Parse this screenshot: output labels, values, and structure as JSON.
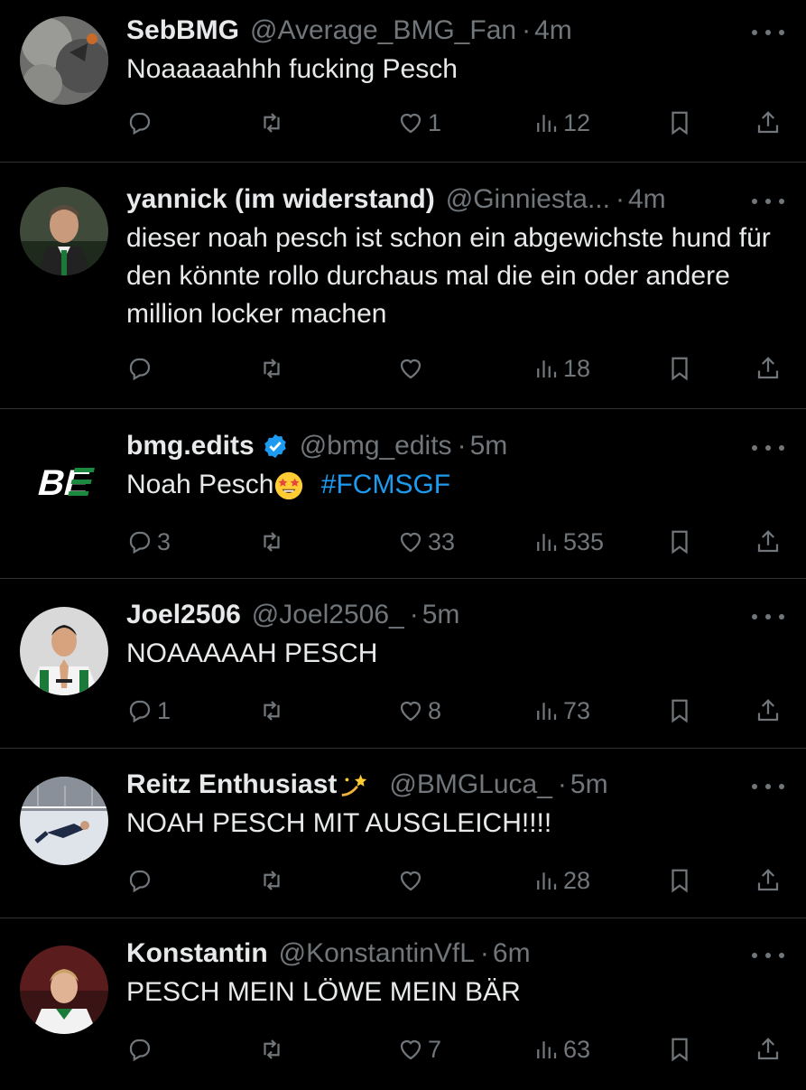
{
  "tweets": [
    {
      "name": "SebBMG",
      "handle": "@Average_BMG_Fan",
      "time": "4m",
      "text": "Noaaaaahhh fucking Pesch",
      "replies": "",
      "retweets": "",
      "likes": "1",
      "views": "12",
      "avatar": "smoky-stadium-avatar"
    },
    {
      "name": "yannick (im widerstand)",
      "handle": "@Ginniesta...",
      "time": "4m",
      "text": "dieser noah pesch ist schon ein abgewichste hund für den könnte rollo durchaus mal die ein oder andere million locker machen",
      "replies": "",
      "retweets": "",
      "likes": "",
      "views": "18",
      "avatar": "man-in-suit-avatar"
    },
    {
      "name": "bmg.edits",
      "handle": "@bmg_edits",
      "time": "5m",
      "text": "Noah Pesch",
      "emoji": "star-struck-emoji",
      "hashtag": "#FCMSGF",
      "replies": "3",
      "retweets": "",
      "likes": "33",
      "views": "535",
      "avatar": "be-logo-avatar",
      "logo_text": "BE",
      "verified": true
    },
    {
      "name": "Joel2506",
      "handle": "@Joel2506_",
      "time": "5m",
      "text": "NOAAAAAH PESCH",
      "replies": "1",
      "retweets": "",
      "likes": "8",
      "views": "73",
      "avatar": "player-praying-avatar"
    },
    {
      "name": "Reitz Enthusiast",
      "name_emoji": "dizzy-emoji",
      "handle": "@BMGLuca_",
      "time": "5m",
      "text": "NOAH PESCH MIT AUSGLEICH!!!!",
      "replies": "",
      "retweets": "",
      "likes": "",
      "views": "28",
      "avatar": "goalkeeper-dive-avatar"
    },
    {
      "name": "Konstantin",
      "handle": "@KonstantinVfL",
      "time": "6m",
      "text": "PESCH MEIN LÖWE MEIN BÄR",
      "replies": "",
      "retweets": "",
      "likes": "7",
      "views": "63",
      "avatar": "young-player-avatar"
    }
  ],
  "colors": {
    "background": "#000000",
    "primary_text": "#e7e9ea",
    "secondary_text": "#71767b",
    "link": "#1d9bf0",
    "divider": "#2f3336"
  },
  "icons": {
    "reply": "reply-icon",
    "retweet": "retweet-icon",
    "like": "heart-icon",
    "views": "views-icon",
    "bookmark": "bookmark-icon",
    "share": "share-icon",
    "more": "more-icon",
    "verified": "verified-badge-icon"
  }
}
